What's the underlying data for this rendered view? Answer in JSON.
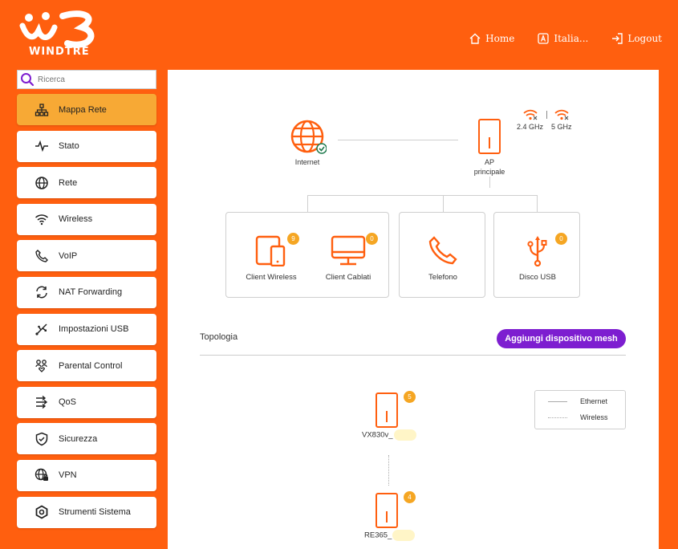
{
  "brand": {
    "name": "WINDTRE",
    "primary": "#ff5f0f",
    "accent": "#f7a935",
    "purple": "#7d1ed0"
  },
  "topnav": [
    {
      "label": "Home",
      "icon": "home-icon"
    },
    {
      "label": "Italia...",
      "icon": "language-icon"
    },
    {
      "label": "Logout",
      "icon": "logout-icon"
    }
  ],
  "search": {
    "placeholder": "Ricerca"
  },
  "sidebar": {
    "items": [
      {
        "label": "Mappa Rete",
        "icon": "network-map-icon",
        "active": true
      },
      {
        "label": "Stato",
        "icon": "pulse-icon"
      },
      {
        "label": "Rete",
        "icon": "globe-icon"
      },
      {
        "label": "Wireless",
        "icon": "wifi-icon"
      },
      {
        "label": "VoIP",
        "icon": "phone-icon"
      },
      {
        "label": "NAT Forwarding",
        "icon": "refresh-icon"
      },
      {
        "label": "Impostazioni USB",
        "icon": "usb-icon"
      },
      {
        "label": "Parental Control",
        "icon": "family-icon"
      },
      {
        "label": "QoS",
        "icon": "qos-icon"
      },
      {
        "label": "Sicurezza",
        "icon": "shield-icon"
      },
      {
        "label": "VPN",
        "icon": "vpn-icon"
      },
      {
        "label": "Strumenti Sistema",
        "icon": "gear-icon"
      }
    ]
  },
  "map": {
    "internet_label": "Internet",
    "ap_label_line1": "AP",
    "ap_label_line2": "principale",
    "wifi_24": "2.4 GHz",
    "wifi_5": "5 GHz",
    "client_wireless": {
      "label": "Client Wireless",
      "count": "9"
    },
    "client_cablati": {
      "label": "Client Cablati",
      "count": "0"
    },
    "telefono": {
      "label": "Telefono"
    },
    "disco_usb": {
      "label": "Disco USB",
      "count": "0"
    }
  },
  "topology": {
    "title": "Topologia",
    "add_mesh_label": "Aggiungi dispositivo mesh",
    "legend": {
      "ethernet": "Ethernet",
      "wireless": "Wireless"
    },
    "devices": [
      {
        "name": "VX830v_",
        "count": "5"
      },
      {
        "name": "RE365_",
        "count": "4"
      }
    ]
  }
}
